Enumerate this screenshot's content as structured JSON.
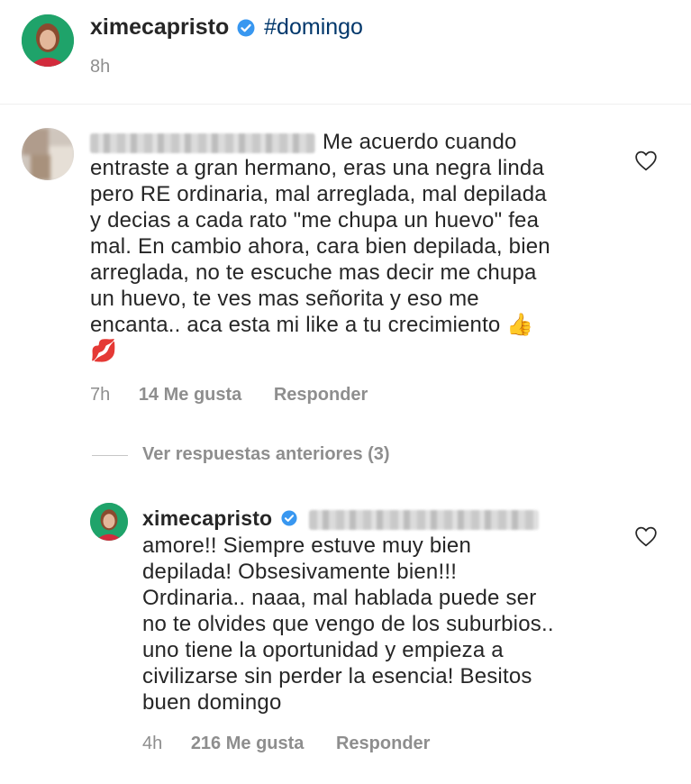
{
  "post": {
    "username": "ximecapristo",
    "caption": "#domingo",
    "time": "8h"
  },
  "comment": {
    "lines": [
      "Me acuerdo cuando",
      "entraste a gran hermano, eras una negra linda",
      "pero RE ordinaria, mal arreglada, mal depilada",
      "y decias a cada rato \"me chupa un huevo\" fea",
      "mal. En cambio ahora, cara bien depilada, bien",
      "arreglada, no te escuche mas decir me chupa",
      "un huevo, te ves mas señorita y eso me",
      "encanta.. aca esta mi like a tu crecimiento"
    ],
    "emoji_thumbs": "👍",
    "emoji_lips": "💋",
    "time": "7h",
    "likes": "14 Me gusta",
    "reply_label": "Responder"
  },
  "view_replies": "Ver respuestas anteriores (3)",
  "reply": {
    "username": "ximecapristo",
    "lines": [
      "amore!! Siempre estuve muy bien",
      "depilada! Obsesivamente bien!!!",
      "Ordinaria.. naaa, mal hablada puede ser",
      "no te olvides que vengo de los suburbios..",
      "uno tiene la oportunidad y empieza a",
      "civilizarse sin perder la esencia! Besitos",
      "buen domingo"
    ],
    "time": "4h",
    "likes": "216 Me gusta",
    "reply_label": "Responder"
  },
  "colors": {
    "verified": "#3897f0",
    "hashtag": "#00376b",
    "meta": "#8e8e8e"
  },
  "icons": [
    "verified-badge-icon",
    "heart-icon"
  ]
}
